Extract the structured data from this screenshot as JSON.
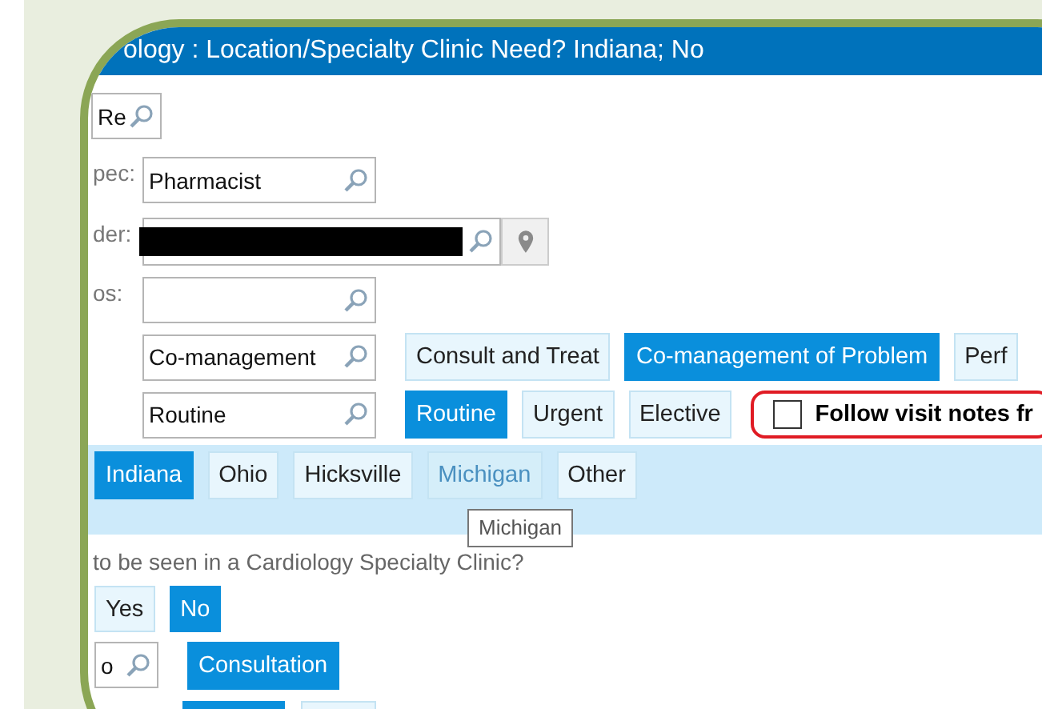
{
  "title": "ology : Location/Specialty Clinic Need? Indiana; No",
  "top_fields": [
    {
      "kind": "short",
      "value": "Re"
    },
    {
      "kind": "labeled",
      "label": "pec:",
      "value": "Pharmacist"
    },
    {
      "kind": "redacted",
      "label": "der:"
    },
    {
      "kind": "labeled",
      "label": "os:"
    }
  ],
  "type_row": {
    "value": "Co-management",
    "options": [
      {
        "label": "Consult and Treat",
        "selected": false
      },
      {
        "label": "Co-management of Problem",
        "selected": true
      },
      {
        "label": "Perf",
        "selected": false
      }
    ]
  },
  "priority_row": {
    "value": "Routine",
    "options": [
      {
        "label": "Routine",
        "selected": true
      },
      {
        "label": "Urgent",
        "selected": false
      },
      {
        "label": "Elective",
        "selected": false
      }
    ],
    "checkbox": {
      "label": "Follow visit notes fr",
      "checked": false
    }
  },
  "locations": [
    {
      "label": "Indiana",
      "selected": true,
      "hovered": false
    },
    {
      "label": "Ohio",
      "selected": false,
      "hovered": false
    },
    {
      "label": "Hicksville",
      "selected": false,
      "hovered": false
    },
    {
      "label": "Michigan",
      "selected": false,
      "hovered": true
    },
    {
      "label": "Other",
      "selected": false,
      "hovered": false
    }
  ],
  "tooltip": "Michigan",
  "question": "to be seen in a Cardiology Specialty Clinic?",
  "answers": [
    {
      "label": "Yes",
      "selected": false
    },
    {
      "label": "No",
      "selected": true
    }
  ],
  "bottom_row": {
    "value": "o",
    "options": [
      {
        "label": "Consultation",
        "selected": true
      }
    ]
  },
  "cut_buttons": [
    {
      "selected": true
    },
    {
      "selected": false
    }
  ]
}
